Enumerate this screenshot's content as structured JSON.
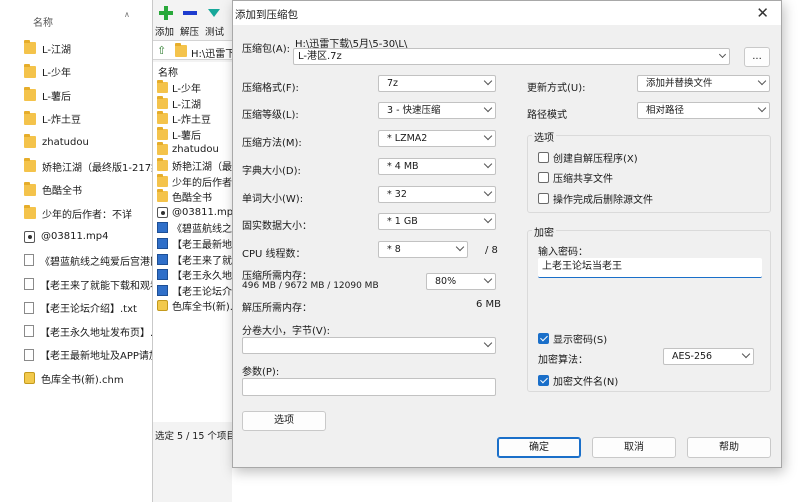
{
  "explorer": {
    "column_header": "名称",
    "items": [
      {
        "icon": "folder-icon",
        "name": "L-江湖"
      },
      {
        "icon": "folder-icon",
        "name": "L-少年"
      },
      {
        "icon": "folder-icon",
        "name": "L-薯后"
      },
      {
        "icon": "folder-icon",
        "name": "L-炸土豆"
      },
      {
        "icon": "folder-icon",
        "name": "zhatudou"
      },
      {
        "icon": "folder-icon",
        "name": "娇艳江湖（最终版1-217集"
      },
      {
        "icon": "folder-icon",
        "name": "色酷全书"
      },
      {
        "icon": "folder-icon",
        "name": "少年的后作者：不详"
      },
      {
        "icon": "media-icon",
        "name": "@03811.mp4"
      },
      {
        "icon": "file-icon",
        "name": "《碧蓝航线之纯爱后宫港区"
      },
      {
        "icon": "file-icon",
        "name": "【老王来了就能下载和观看"
      },
      {
        "icon": "file-icon",
        "name": "【老王论坛介绍】.txt"
      },
      {
        "icon": "file-icon",
        "name": "【老王永久地址发布页】."
      },
      {
        "icon": "file-icon",
        "name": "【老王最新地址及APP请加"
      },
      {
        "icon": "chm-icon",
        "name": "色库全书(新).chm"
      }
    ]
  },
  "file_manager": {
    "toolbar": {
      "add": "添加",
      "extract": "解压",
      "test": "测试"
    },
    "address": "H:\\迅雷下",
    "list_header": "名称",
    "rows": [
      {
        "icon": "folder-icon",
        "name": "L-少年"
      },
      {
        "icon": "folder-icon",
        "name": "L-江湖"
      },
      {
        "icon": "folder-icon",
        "name": "L-炸土豆"
      },
      {
        "icon": "folder-icon",
        "name": "L-薯后"
      },
      {
        "icon": "folder-icon",
        "name": "zhatudou"
      },
      {
        "icon": "folder-icon",
        "name": "娇艳江湖（最"
      },
      {
        "icon": "folder-icon",
        "name": "少年的后作者"
      },
      {
        "icon": "folder-icon",
        "name": "色酷全书"
      },
      {
        "icon": "media-icon",
        "name": "@03811.mp4"
      },
      {
        "icon": "doc-icon",
        "name": "《碧蓝航线之"
      },
      {
        "icon": "doc-icon",
        "name": "【老王最新地"
      },
      {
        "icon": "doc-icon",
        "name": "【老王来了就"
      },
      {
        "icon": "doc-icon",
        "name": "【老王永久地"
      },
      {
        "icon": "doc-icon",
        "name": "【老王论坛介"
      },
      {
        "icon": "chm-icon",
        "name": "色库全书(新)."
      }
    ],
    "status": "选定 5 / 15 个项目"
  },
  "dialog": {
    "title": "添加到压缩包",
    "archive_label": "压缩包(A):",
    "archive_path": "H:\\迅雷下载\\5月\\5-30\\L\\",
    "archive_name": "L-港区.7z",
    "browse_label": "...",
    "format_label": "压缩格式(F):",
    "format_value": "7z",
    "level_label": "压缩等级(L):",
    "level_value": "3 - 快速压缩",
    "method_label": "压缩方法(M):",
    "method_value": "* LZMA2",
    "dict_label": "字典大小(D):",
    "dict_value": "* 4 MB",
    "word_label": "单词大小(W):",
    "word_value": "* 32",
    "solid_label": "固实数据大小：",
    "solid_value": "* 1 GB",
    "cpu_label": "CPU 线程数：",
    "cpu_value": "* 8",
    "cpu_max": "/ 8",
    "mem_comp_label": "压缩所需内存：",
    "mem_comp_value": "496 MB / 9672 MB / 12090 MB",
    "mem_percent": "80%",
    "mem_decomp_label": "解压所需内存：",
    "mem_decomp_value": "6 MB",
    "split_label": "分卷大小，字节(V):",
    "split_value": "",
    "params_label": "参数(P):",
    "params_value": "",
    "options_button": "选项",
    "update_label": "更新方式(U):",
    "update_value": "添加并替换文件",
    "path_label": "路径模式",
    "path_value": "相对路径",
    "options_group": "选项",
    "opt_sfx": "创建自解压程序(X)",
    "opt_shared": "压缩共享文件",
    "opt_delete": "操作完成后删除源文件",
    "encrypt_group": "加密",
    "password_label": "输入密码：",
    "password_value": "上老王论坛当老王",
    "show_password": "显示密码(S)",
    "algo_label": "加密算法：",
    "algo_value": "AES-256",
    "encrypt_names": "加密文件名(N)",
    "ok_button": "确定",
    "cancel_button": "取消",
    "help_button": "帮助"
  },
  "checkboxes": {
    "sfx": false,
    "shared": false,
    "delete": false,
    "show_password": true,
    "encrypt_names": true
  },
  "colors": {
    "accent": "#1a6fc9",
    "folder": "#f4c34b",
    "dialog_bg": "#f0f0f0"
  }
}
